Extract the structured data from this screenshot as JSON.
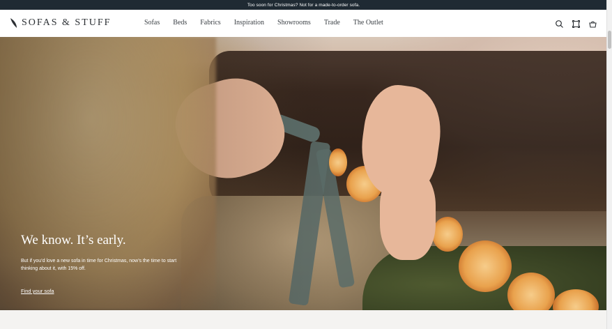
{
  "announcement": "Too soon for Christmas? Not for a made-to-order sofa.",
  "brand": {
    "name": "SOFAS & STUFF",
    "colors": {
      "bar": "#1f2a33",
      "text": "#2b2f33"
    }
  },
  "nav": [
    "Sofas",
    "Beds",
    "Fabrics",
    "Inspiration",
    "Showrooms",
    "Trade",
    "The Outlet"
  ],
  "header_icons": [
    "search-icon",
    "swatch-icon",
    "basket-icon"
  ],
  "hero": {
    "title": "We know. It’s early.",
    "text": "But if you’d love a new sofa in time for Christmas, now’s the time to start thinking about it, with 15% off.",
    "link": "Find your sofa"
  }
}
